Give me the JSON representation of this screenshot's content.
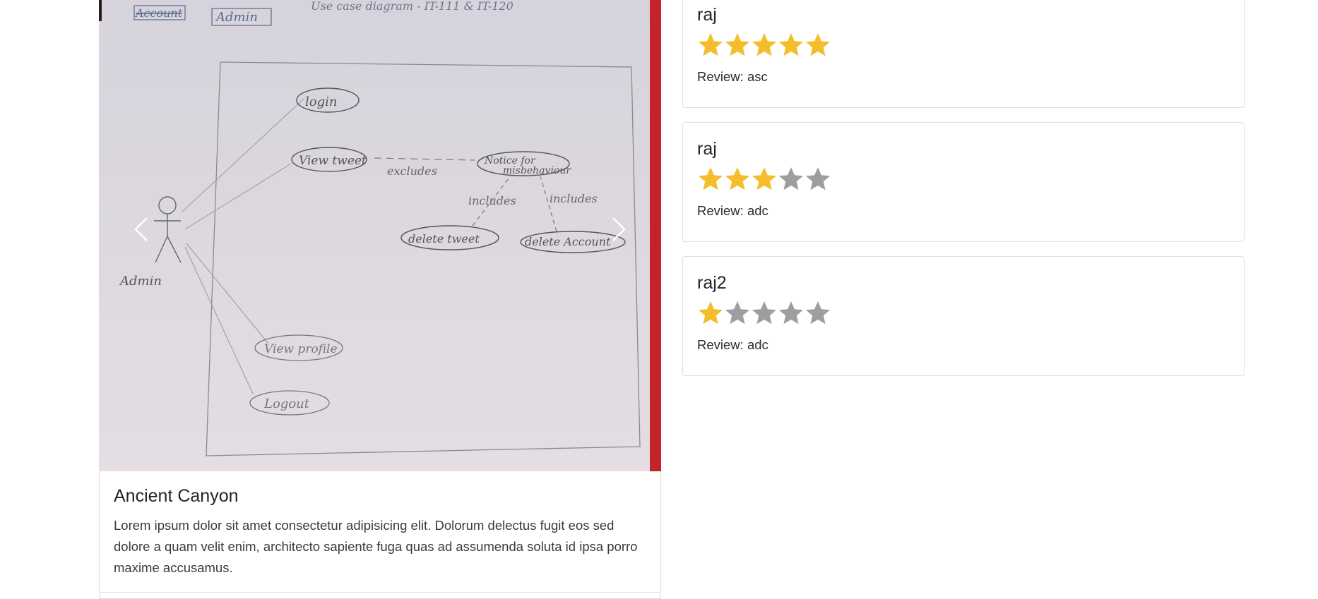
{
  "carousel": {
    "slide_label": "Admin",
    "sketch_header": "Account",
    "sketch_header_2": "Admin",
    "sketch_top_text": "Use case diagram - IT-111 & IT-120",
    "use_cases": [
      "login",
      "View tweet",
      "Notice for misbehaviour",
      "delete tweet",
      "delete Account",
      "View profile",
      "Logout"
    ],
    "relations": [
      "excludes",
      "includes",
      "includes"
    ],
    "actor": "Admin",
    "prev_label": "Previous",
    "next_label": "Next"
  },
  "campground": {
    "title": "Ancient Canyon",
    "description": "Lorem ipsum dolor sit amet consectetur adipisicing elit. Dolorum delectus fugit eos sed dolore a quam velit enim, architecto sapiente fuga quas ad assumenda soluta id ipsa porro maxime accusamus."
  },
  "reviews": [
    {
      "author": "raj",
      "rating": 5,
      "max": 5,
      "text": "Review: asc"
    },
    {
      "author": "raj",
      "rating": 3,
      "max": 5,
      "text": "Review: adc"
    },
    {
      "author": "raj2",
      "rating": 1,
      "max": 5,
      "text": "Review: adc"
    }
  ],
  "colors": {
    "star_filled": "#f5bd2b",
    "star_empty": "#9e9e9e",
    "border": "#dfdfdf"
  }
}
